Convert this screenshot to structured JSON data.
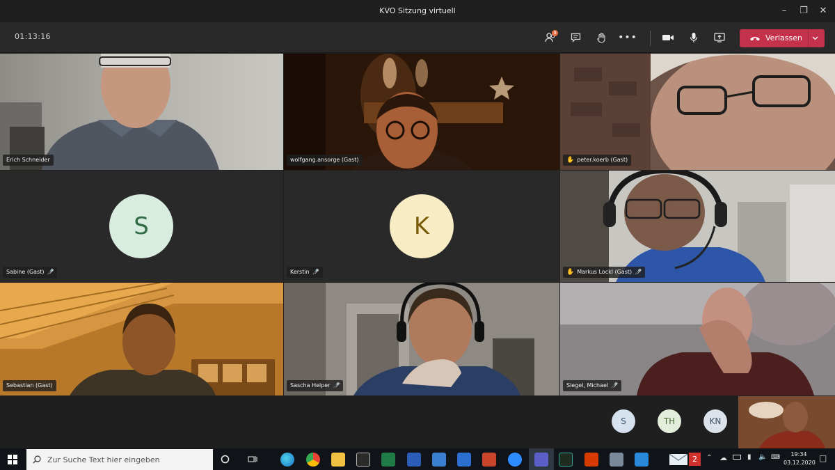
{
  "window": {
    "title": "KVO Sitzung virtuell"
  },
  "toolbar": {
    "timer": "01:13:16",
    "participants_badge": "9",
    "leave_label": "Verlassen"
  },
  "participants": [
    {
      "name": "Erich Schneider",
      "muted": false,
      "hand": false
    },
    {
      "name": "wolfgang.ansorge (Gast)",
      "muted": false,
      "hand": false
    },
    {
      "name": "peter.koerb (Gast)",
      "muted": false,
      "hand": true
    },
    {
      "name": "Sabine (Gast)",
      "muted": true,
      "hand": false,
      "initial": "S"
    },
    {
      "name": "Kerstin",
      "muted": true,
      "hand": false,
      "initial": "K"
    },
    {
      "name": "Markus Lockl (Gast)",
      "muted": true,
      "hand": true
    },
    {
      "name": "Sebastian (Gast)",
      "muted": false,
      "hand": false
    },
    {
      "name": "Sascha Helper",
      "muted": true,
      "hand": false
    },
    {
      "name": "Siegel, Michael",
      "muted": true,
      "hand": false
    }
  ],
  "roster": [
    "S",
    "TH",
    "KN"
  ],
  "taskbar": {
    "search_placeholder": "Zur Suche Text hier eingeben",
    "mail_badge": "2",
    "time": "19:34",
    "date": "03.12.2020"
  },
  "colors": {
    "leave": "#c4314b",
    "avatar_sabine": "#d9ece0",
    "avatar_kerstin": "#f8ecc4",
    "hand": "#f2b400"
  }
}
